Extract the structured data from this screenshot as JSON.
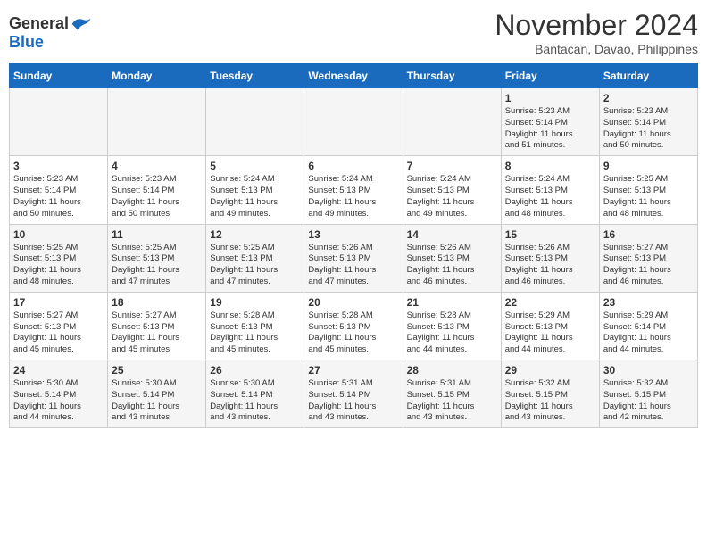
{
  "header": {
    "logo_general": "General",
    "logo_blue": "Blue",
    "month_title": "November 2024",
    "subtitle": "Bantacan, Davao, Philippines"
  },
  "days_of_week": [
    "Sunday",
    "Monday",
    "Tuesday",
    "Wednesday",
    "Thursday",
    "Friday",
    "Saturday"
  ],
  "weeks": [
    [
      {
        "day": "",
        "info": ""
      },
      {
        "day": "",
        "info": ""
      },
      {
        "day": "",
        "info": ""
      },
      {
        "day": "",
        "info": ""
      },
      {
        "day": "",
        "info": ""
      },
      {
        "day": "1",
        "info": "Sunrise: 5:23 AM\nSunset: 5:14 PM\nDaylight: 11 hours\nand 51 minutes."
      },
      {
        "day": "2",
        "info": "Sunrise: 5:23 AM\nSunset: 5:14 PM\nDaylight: 11 hours\nand 50 minutes."
      }
    ],
    [
      {
        "day": "3",
        "info": "Sunrise: 5:23 AM\nSunset: 5:14 PM\nDaylight: 11 hours\nand 50 minutes."
      },
      {
        "day": "4",
        "info": "Sunrise: 5:23 AM\nSunset: 5:14 PM\nDaylight: 11 hours\nand 50 minutes."
      },
      {
        "day": "5",
        "info": "Sunrise: 5:24 AM\nSunset: 5:13 PM\nDaylight: 11 hours\nand 49 minutes."
      },
      {
        "day": "6",
        "info": "Sunrise: 5:24 AM\nSunset: 5:13 PM\nDaylight: 11 hours\nand 49 minutes."
      },
      {
        "day": "7",
        "info": "Sunrise: 5:24 AM\nSunset: 5:13 PM\nDaylight: 11 hours\nand 49 minutes."
      },
      {
        "day": "8",
        "info": "Sunrise: 5:24 AM\nSunset: 5:13 PM\nDaylight: 11 hours\nand 48 minutes."
      },
      {
        "day": "9",
        "info": "Sunrise: 5:25 AM\nSunset: 5:13 PM\nDaylight: 11 hours\nand 48 minutes."
      }
    ],
    [
      {
        "day": "10",
        "info": "Sunrise: 5:25 AM\nSunset: 5:13 PM\nDaylight: 11 hours\nand 48 minutes."
      },
      {
        "day": "11",
        "info": "Sunrise: 5:25 AM\nSunset: 5:13 PM\nDaylight: 11 hours\nand 47 minutes."
      },
      {
        "day": "12",
        "info": "Sunrise: 5:25 AM\nSunset: 5:13 PM\nDaylight: 11 hours\nand 47 minutes."
      },
      {
        "day": "13",
        "info": "Sunrise: 5:26 AM\nSunset: 5:13 PM\nDaylight: 11 hours\nand 47 minutes."
      },
      {
        "day": "14",
        "info": "Sunrise: 5:26 AM\nSunset: 5:13 PM\nDaylight: 11 hours\nand 46 minutes."
      },
      {
        "day": "15",
        "info": "Sunrise: 5:26 AM\nSunset: 5:13 PM\nDaylight: 11 hours\nand 46 minutes."
      },
      {
        "day": "16",
        "info": "Sunrise: 5:27 AM\nSunset: 5:13 PM\nDaylight: 11 hours\nand 46 minutes."
      }
    ],
    [
      {
        "day": "17",
        "info": "Sunrise: 5:27 AM\nSunset: 5:13 PM\nDaylight: 11 hours\nand 45 minutes."
      },
      {
        "day": "18",
        "info": "Sunrise: 5:27 AM\nSunset: 5:13 PM\nDaylight: 11 hours\nand 45 minutes."
      },
      {
        "day": "19",
        "info": "Sunrise: 5:28 AM\nSunset: 5:13 PM\nDaylight: 11 hours\nand 45 minutes."
      },
      {
        "day": "20",
        "info": "Sunrise: 5:28 AM\nSunset: 5:13 PM\nDaylight: 11 hours\nand 45 minutes."
      },
      {
        "day": "21",
        "info": "Sunrise: 5:28 AM\nSunset: 5:13 PM\nDaylight: 11 hours\nand 44 minutes."
      },
      {
        "day": "22",
        "info": "Sunrise: 5:29 AM\nSunset: 5:13 PM\nDaylight: 11 hours\nand 44 minutes."
      },
      {
        "day": "23",
        "info": "Sunrise: 5:29 AM\nSunset: 5:14 PM\nDaylight: 11 hours\nand 44 minutes."
      }
    ],
    [
      {
        "day": "24",
        "info": "Sunrise: 5:30 AM\nSunset: 5:14 PM\nDaylight: 11 hours\nand 44 minutes."
      },
      {
        "day": "25",
        "info": "Sunrise: 5:30 AM\nSunset: 5:14 PM\nDaylight: 11 hours\nand 43 minutes."
      },
      {
        "day": "26",
        "info": "Sunrise: 5:30 AM\nSunset: 5:14 PM\nDaylight: 11 hours\nand 43 minutes."
      },
      {
        "day": "27",
        "info": "Sunrise: 5:31 AM\nSunset: 5:14 PM\nDaylight: 11 hours\nand 43 minutes."
      },
      {
        "day": "28",
        "info": "Sunrise: 5:31 AM\nSunset: 5:15 PM\nDaylight: 11 hours\nand 43 minutes."
      },
      {
        "day": "29",
        "info": "Sunrise: 5:32 AM\nSunset: 5:15 PM\nDaylight: 11 hours\nand 43 minutes."
      },
      {
        "day": "30",
        "info": "Sunrise: 5:32 AM\nSunset: 5:15 PM\nDaylight: 11 hours\nand 42 minutes."
      }
    ]
  ]
}
